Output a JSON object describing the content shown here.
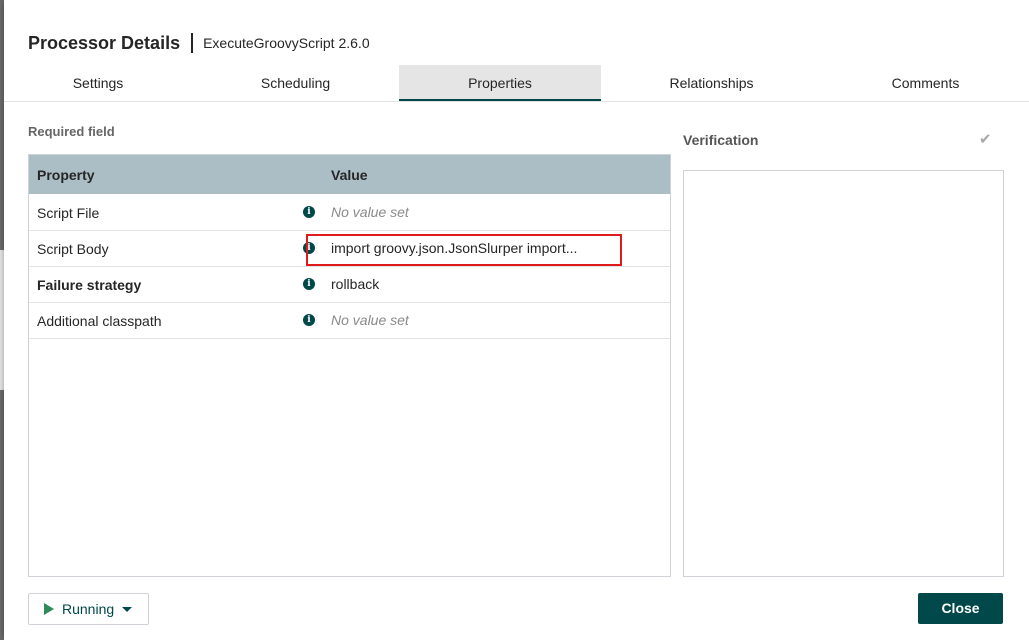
{
  "dialog": {
    "title": "Processor Details",
    "subtitle": "ExecuteGroovyScript 2.6.0"
  },
  "tabs": [
    {
      "label": "Settings",
      "active": false
    },
    {
      "label": "Scheduling",
      "active": false
    },
    {
      "label": "Properties",
      "active": true
    },
    {
      "label": "Relationships",
      "active": false
    },
    {
      "label": "Comments",
      "active": false
    }
  ],
  "properties": {
    "required_label": "Required field",
    "columns": {
      "property": "Property",
      "value": "Value"
    },
    "rows": [
      {
        "name": "Script File",
        "value": "No value set",
        "required": false,
        "empty": true
      },
      {
        "name": "Script Body",
        "value": "import groovy.json.JsonSlurper import...",
        "required": false,
        "empty": false
      },
      {
        "name": "Failure strategy",
        "value": "rollback",
        "required": true,
        "empty": false
      },
      {
        "name": "Additional classpath",
        "value": "No value set",
        "required": false,
        "empty": true
      }
    ]
  },
  "verification": {
    "label": "Verification",
    "icon": "checkmark-icon"
  },
  "footer": {
    "run_state": "Running",
    "close_label": "Close"
  },
  "colors": {
    "accent": "#004849",
    "table_header": "#abbdc5",
    "highlight": "#e01b1b",
    "play": "#2e8b57"
  }
}
